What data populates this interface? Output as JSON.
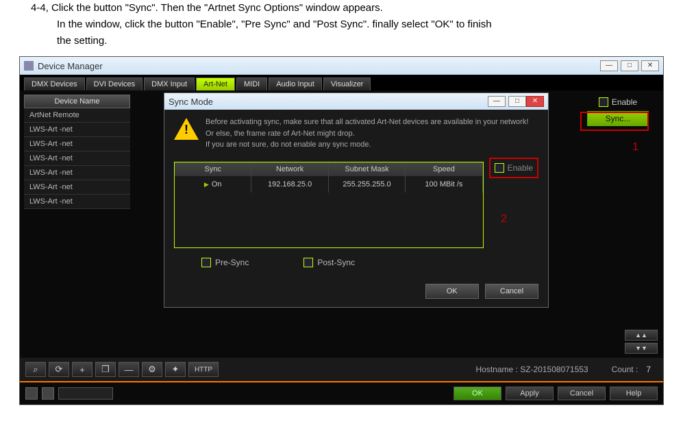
{
  "instructions": {
    "line1": "4-4, Click the button \"Sync\". Then the \"Artnet Sync Options\" window appears.",
    "line2": "In the window, click the button \"Enable\", \"Pre Sync\" and \"Post Sync\". finally select \"OK\" to finish",
    "line3": "the setting."
  },
  "app": {
    "title": "Device Manager"
  },
  "winctrl": {
    "min": "—",
    "max": "□",
    "close": "✕"
  },
  "tabs": [
    "DMX Devices",
    "DVI Devices",
    "DMX Input",
    "Art-Net",
    "MIDI",
    "Audio Input",
    "Visualizer"
  ],
  "activeTabIdx": 3,
  "devheader": "Device Name",
  "devices": [
    "ArtNet Remote",
    "LWS-Art -net",
    "LWS-Art -net",
    "LWS-Art -net",
    "LWS-Art -net",
    "LWS-Art -net",
    "LWS-Art -net"
  ],
  "right": {
    "enable": "Enable",
    "sync": "Sync..."
  },
  "redmark": {
    "one": "1",
    "two": "2"
  },
  "dialog": {
    "title": "Sync Mode",
    "warn1": "Before activating sync, make sure that all activated Art-Net devices are available in your network!",
    "warn2": "Or else, the frame rate of Art-Net might drop.",
    "warn3": "If you are not sure, do not enable any sync mode.",
    "headers": {
      "sync": "Sync",
      "network": "Network",
      "mask": "Subnet Mask",
      "speed": "Speed"
    },
    "row": {
      "sync": "On",
      "network": "192.168.25.0",
      "mask": "255.255.255.0",
      "speed": "100 MBit /s"
    },
    "enable": "Enable",
    "presync": "Pre-Sync",
    "postsync": "Post-Sync",
    "ok": "OK",
    "cancel": "Cancel"
  },
  "toolbar": {
    "search": "⌕",
    "refresh": "⟳",
    "add": "+",
    "copy": "❐",
    "minus": "—",
    "gear": "⚙",
    "gear2": "✦",
    "http": "HTTP",
    "hostname_lbl": "Hostname :",
    "hostname": "SZ-201508071553",
    "count_lbl": "Count :",
    "count": "7",
    "up": "▲▲",
    "down": "▼▼"
  },
  "footer": {
    "ok": "OK",
    "apply": "Apply",
    "cancel": "Cancel",
    "help": "Help"
  }
}
